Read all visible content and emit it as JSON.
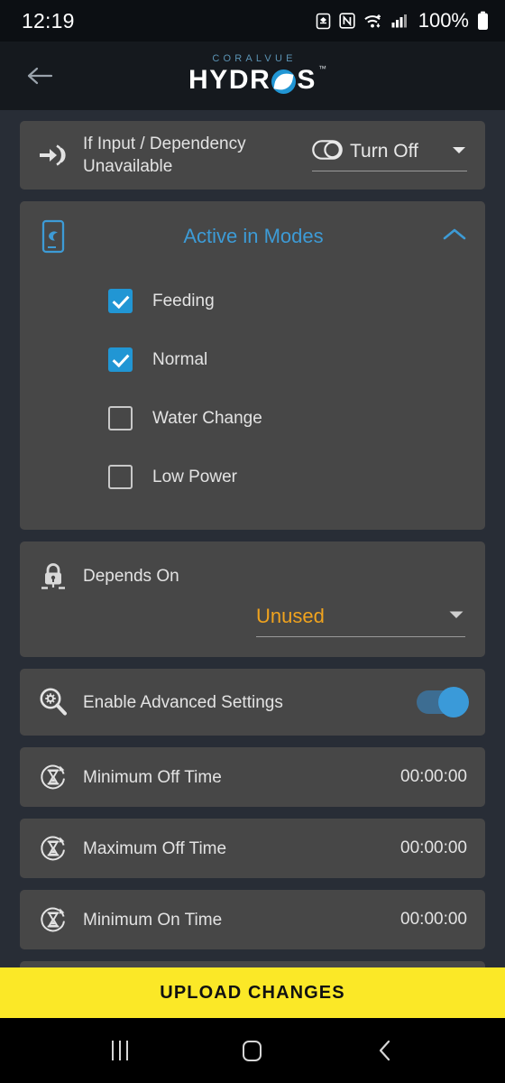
{
  "status_bar": {
    "time": "12:19",
    "battery_percent": "100%",
    "icons": [
      "battery-saver-icon",
      "nfc-icon",
      "wifi-icon",
      "cellular-signal-icon",
      "battery-icon"
    ]
  },
  "header": {
    "back_icon": "back-arrow-icon",
    "brand_top": "CORALVUE",
    "brand_left": "HYDR",
    "brand_right": "S",
    "brand_tm": "™"
  },
  "dependency_card": {
    "icon": "input-arrow-icon",
    "label": "If Input / Dependency Unavailable",
    "select_icon": "toggle-off-icon",
    "select_value": "Turn Off",
    "chevron": "chevron-down-icon"
  },
  "modes_card": {
    "icon": "device-mode-icon",
    "title": "Active in Modes",
    "collapse_icon": "chevron-up-icon",
    "modes": [
      {
        "label": "Feeding",
        "checked": true
      },
      {
        "label": "Normal",
        "checked": true
      },
      {
        "label": "Water Change",
        "checked": false
      },
      {
        "label": "Low Power",
        "checked": false
      }
    ]
  },
  "depends_card": {
    "icon": "lock-icon",
    "label": "Depends On",
    "value": "Unused",
    "chevron": "chevron-down-icon"
  },
  "advanced_card": {
    "icon": "advanced-search-icon",
    "label": "Enable Advanced Settings",
    "toggle_on": true
  },
  "timer_rows": [
    {
      "icon": "hourglass-icon",
      "label": "Minimum Off Time",
      "value": "00:00:00"
    },
    {
      "icon": "hourglass-icon",
      "label": "Maximum Off Time",
      "value": "00:00:00"
    },
    {
      "icon": "hourglass-icon",
      "label": "Minimum On Time",
      "value": "00:00:00"
    }
  ],
  "upload_button": {
    "label": "UPLOAD CHANGES"
  },
  "nav_bar": {
    "recents": "recents-icon",
    "home": "home-icon",
    "back": "back-icon"
  },
  "colors": {
    "page_background": "#282d36",
    "card_background": "#474747",
    "accent_blue": "#3d9bd6",
    "accent_orange": "#f0a31e",
    "upload_yellow": "#fbe827",
    "header_background": "#15191e"
  }
}
